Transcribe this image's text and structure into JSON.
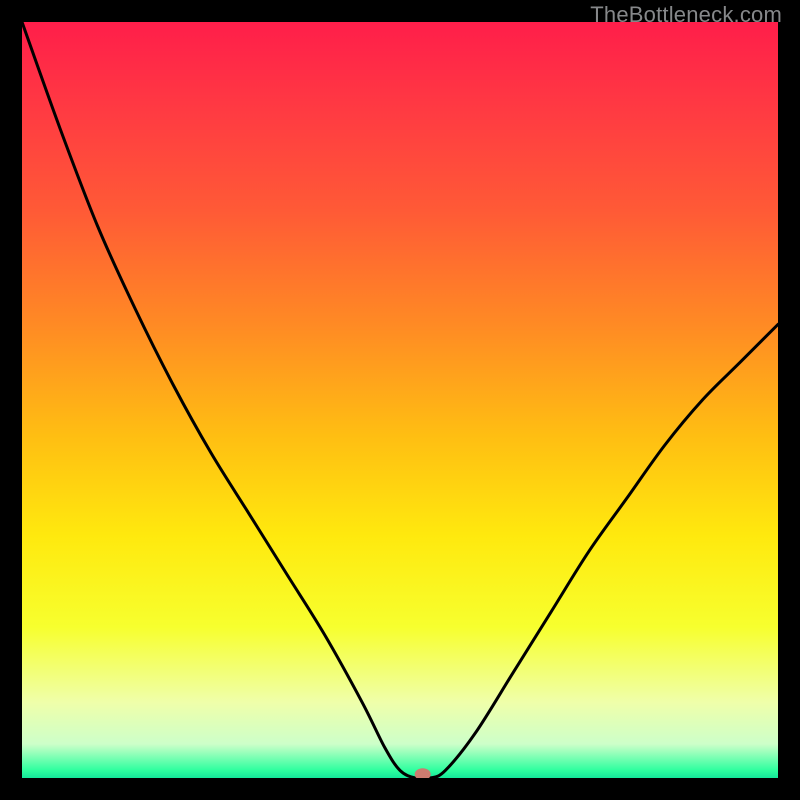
{
  "watermark": "TheBottleneck.com",
  "chart_data": {
    "type": "line",
    "title": "",
    "xlabel": "",
    "ylabel": "",
    "xlim": [
      0,
      100
    ],
    "ylim": [
      0,
      100
    ],
    "grid": false,
    "series": [
      {
        "name": "curve",
        "x": [
          0,
          5,
          10,
          15,
          20,
          25,
          30,
          35,
          40,
          45,
          48,
          50,
          52,
          54,
          56,
          60,
          65,
          70,
          75,
          80,
          85,
          90,
          95,
          100
        ],
        "values": [
          100,
          86,
          73,
          62,
          52,
          43,
          35,
          27,
          19,
          10,
          4,
          1,
          0,
          0,
          1,
          6,
          14,
          22,
          30,
          37,
          44,
          50,
          55,
          60
        ]
      }
    ],
    "marker": {
      "x": 53,
      "y": 0.5,
      "color": "#cc7b6f"
    },
    "background_gradient": {
      "stops": [
        {
          "offset": 0.0,
          "color": "#ff1e4a"
        },
        {
          "offset": 0.12,
          "color": "#ff3b42"
        },
        {
          "offset": 0.25,
          "color": "#ff5a36"
        },
        {
          "offset": 0.4,
          "color": "#ff8a24"
        },
        {
          "offset": 0.55,
          "color": "#ffbf12"
        },
        {
          "offset": 0.68,
          "color": "#ffe90e"
        },
        {
          "offset": 0.8,
          "color": "#f7ff2e"
        },
        {
          "offset": 0.9,
          "color": "#efffaa"
        },
        {
          "offset": 0.955,
          "color": "#cdffc9"
        },
        {
          "offset": 0.99,
          "color": "#2dff9f"
        },
        {
          "offset": 1.0,
          "color": "#14e79a"
        }
      ]
    }
  }
}
